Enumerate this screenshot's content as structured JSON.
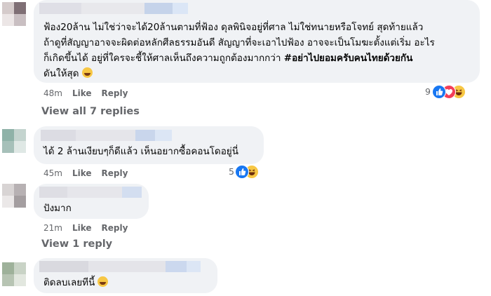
{
  "comments": [
    {
      "lines": [
        "ฟ้อง20ล้าน ไม่ใช่ว่าจะได้20ล้านตามที่ฟ้อง ดุลพินิจอยู่ที่ศาล ไม่ใช่ทนายหรือโจทย์ สุดท้ายแล้ว",
        "ถ้าดูที่สัญญาอาจจะผิดต่อหลักศีลธรรมอันดี สัญญาที่จะเอาไปฟ้อง อาจจะเป็นโมฆะตั้งแต่เริ่ม อะไร",
        "ก็เกิดขึ้นได้ อยู่ที่ใครจะชี้ให้ศาลเห็นถึงความถูกต้องมากกว่า",
        "ดันให้สุด"
      ],
      "hashtag": "#อย่าไปยอมครับคนไทยด้วยกัน",
      "time": "48m",
      "like": "Like",
      "reply": "Reply",
      "reaction_count": "9",
      "reactions": [
        "like-reaction-icon",
        "love-reaction-icon",
        "haha-reaction-icon"
      ],
      "emoji": "grinning-face-icon"
    },
    {
      "lines": [
        "ได้ 2 ล้านเงียบๆก็ดีแล้ว เห็นอยากซื้อคอนโดอยู่นี่"
      ],
      "time": "45m",
      "like": "Like",
      "reply": "Reply",
      "reaction_count": "5",
      "reactions": [
        "like-reaction-icon",
        "haha-reaction-icon"
      ]
    },
    {
      "lines": [
        "ปังมาก"
      ],
      "time": "21m",
      "like": "Like",
      "reply": "Reply"
    },
    {
      "lines": [
        "ติดลบเลยทีนี้"
      ],
      "emoji": "laughing-face-icon"
    }
  ],
  "view_all_replies": "View all 7 replies",
  "view_one_reply": "View 1 reply",
  "colors": {
    "bubble": "#f0f2f5",
    "meta_text": "#65676b",
    "like_blue": "#1877f2",
    "love_red": "#f33e58",
    "haha_yellow": "#f7c744"
  }
}
